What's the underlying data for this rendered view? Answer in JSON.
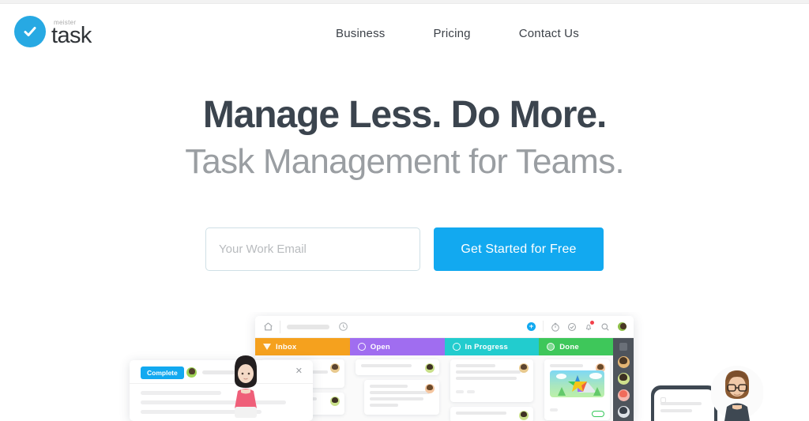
{
  "brand": {
    "meister_label": "meister",
    "task_label": "task",
    "logo_color": "#27a9e3",
    "check_icon": "check-icon"
  },
  "nav": {
    "items": [
      {
        "label": "Business"
      },
      {
        "label": "Pricing"
      },
      {
        "label": "Contact Us"
      }
    ]
  },
  "hero": {
    "headline": "Manage Less. Do More.",
    "subheadline": "Task Management for Teams.",
    "headline_color": "#3b444e",
    "subheadline_color": "#9a9ea2"
  },
  "signup": {
    "email_placeholder": "Your Work Email",
    "email_value": "",
    "cta_label": "Get Started for Free",
    "cta_color": "#12a9f0"
  },
  "app_preview": {
    "toolbar": {
      "home_icon": "home-icon",
      "search_icon": "search-field",
      "clock_icon": "clock-icon",
      "add_icon": "plus-icon",
      "timer_icon": "timer-icon",
      "check_circle_icon": "check-circle-icon",
      "notification_icon": "bell-icon",
      "search_right_icon": "search-icon",
      "avatar_icon": "user-avatar"
    },
    "columns": [
      {
        "label": "Inbox",
        "color": "#f5a11e",
        "icon": "inbox-icon"
      },
      {
        "label": "Open",
        "color": "#a06df0",
        "icon": "circle-icon"
      },
      {
        "label": "In Progress",
        "color": "#22ccce",
        "icon": "progress-icon"
      },
      {
        "label": "Done",
        "color": "#3ec75a",
        "icon": "check-circle-icon"
      }
    ],
    "detail_card": {
      "complete_label": "Complete",
      "close_icon": "close-icon",
      "avatar": "user-avatar"
    },
    "illustrations": {
      "woman": "woman-character",
      "man": "man-character-with-glasses",
      "phone": "mobile-phone-device"
    },
    "sidebar": {
      "board_icon": "board-icon",
      "avatars": [
        "user-avatar",
        "user-avatar",
        "user-avatar",
        "user-avatar"
      ]
    }
  }
}
